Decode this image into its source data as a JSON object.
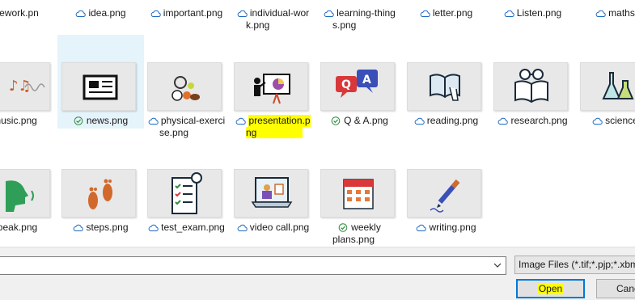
{
  "top_row": [
    {
      "label": "mework.pn",
      "status": "none"
    },
    {
      "label": "idea.png",
      "status": "cloud"
    },
    {
      "label": "important.png",
      "status": "cloud"
    },
    {
      "label": "individual-wor",
      "label2": "k.png",
      "status": "cloud"
    },
    {
      "label": "learning-thing",
      "label2": "s.png",
      "status": "cloud"
    },
    {
      "label": "letter.png",
      "status": "cloud"
    },
    {
      "label": "Listen.png",
      "status": "cloud"
    },
    {
      "label": "maths.p",
      "status": "cloud"
    }
  ],
  "row2": [
    {
      "label": "music.png",
      "status": "none",
      "icon": "music-notes-icon"
    },
    {
      "label": "news.png",
      "status": "check",
      "icon": "newspaper-icon",
      "selected": true
    },
    {
      "label": "physical-exerci",
      "label2": "se.png",
      "status": "cloud",
      "icon": "sports-balls-icon"
    },
    {
      "label": "presentation.p",
      "label2": "ng",
      "status": "cloud",
      "icon": "presentation-board-icon",
      "highlight": true
    },
    {
      "label": "Q & A.png",
      "status": "check",
      "icon": "qa-speech-bubbles-icon"
    },
    {
      "label": "reading.png",
      "status": "cloud",
      "icon": "open-book-hand-icon"
    },
    {
      "label": "research.png",
      "status": "cloud",
      "icon": "book-glasses-icon"
    },
    {
      "label": "science.p",
      "status": "cloud",
      "icon": "lab-flasks-icon"
    }
  ],
  "row3": [
    {
      "label": "speak.png",
      "status": "none",
      "icon": "speaking-head-icon"
    },
    {
      "label": "steps.png",
      "status": "cloud",
      "icon": "footprints-icon"
    },
    {
      "label": "test_exam.png",
      "status": "cloud",
      "icon": "checklist-stopwatch-icon"
    },
    {
      "label": "video call.png",
      "status": "cloud",
      "icon": "video-call-laptop-icon"
    },
    {
      "label": "weekly",
      "label2": "plans.png",
      "status": "check",
      "icon": "calendar-icon"
    },
    {
      "label": "writing.png",
      "status": "cloud",
      "icon": "pen-writing-icon"
    }
  ],
  "filename_value": "",
  "filetype_value": "Image Files (*.tif;*.pjp;*.xbm",
  "open_label": "Open",
  "cancel_label": "Cancel",
  "colors": {
    "selection": "#e5f3fb",
    "highlight": "#ffff00",
    "button_focus": "#0078d7",
    "cloud": "#1e6ac2",
    "check": "#2e8b3e"
  }
}
